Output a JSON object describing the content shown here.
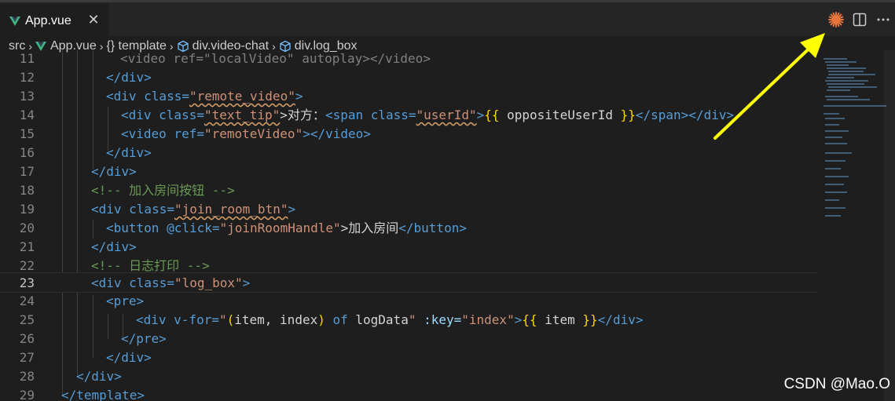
{
  "tab": {
    "title": "App.vue",
    "close": "✕"
  },
  "breadcrumb": [
    {
      "text": "src"
    },
    {
      "text": "App.vue"
    },
    {
      "text": "{} template"
    },
    {
      "text": "div.video-chat"
    },
    {
      "text": "div.log_box"
    }
  ],
  "lines": [
    {
      "n": "11"
    },
    {
      "n": "12"
    },
    {
      "n": "13"
    },
    {
      "n": "14"
    },
    {
      "n": "15"
    },
    {
      "n": "16"
    },
    {
      "n": "17"
    },
    {
      "n": "18"
    },
    {
      "n": "19"
    },
    {
      "n": "20"
    },
    {
      "n": "21"
    },
    {
      "n": "22"
    },
    {
      "n": "23"
    },
    {
      "n": "24"
    },
    {
      "n": "25"
    },
    {
      "n": "26"
    },
    {
      "n": "27"
    },
    {
      "n": "28"
    },
    {
      "n": "29"
    }
  ],
  "code": {
    "l11a": "<video ref=\"localVideo\" autoplay></video>",
    "l12": "</div>",
    "l13a": "<div class=",
    "l13b": "\"remote_video\"",
    "l13c": ">",
    "l14a": "<div class=",
    "l14b": "\"text_tip\"",
    "l14c": ">对方：",
    "l14d": "<span class=",
    "l14e": "\"userId\"",
    "l14f": ">",
    "l14g": "{{",
    "l14h": " oppositeUserId ",
    "l14i": "}}",
    "l14j": "</span></div>",
    "l15a": "<video ref=",
    "l15b": "\"remoteVideo\"",
    "l15c": "></video>",
    "l16": "</div>",
    "l17": "</div>",
    "l18": "<!-- 加入房间按钮 -->",
    "l19a": "<div class=",
    "l19b": "\"join_room_btn\"",
    "l19c": ">",
    "l20a": "<button @click=",
    "l20b": "\"joinRoomHandle\"",
    "l20c": ">加入房间",
    "l20d": "</button>",
    "l21": "</div>",
    "l22": "<!-- 日志打印 -->",
    "l23a": "<div class=",
    "l23b": "\"log_box\"",
    "l23c": ">",
    "l24": "<pre>",
    "l25a": "<div v-for=",
    "l25b": "\"",
    "l25c": "(",
    "l25d": "item, index",
    "l25e": ")",
    "l25f": " of ",
    "l25g": "logData",
    "l25h": "\"",
    "l25i": " :key=",
    "l25j": "\"index\"",
    "l25k": ">",
    "l25l": "{{",
    "l25m": " item ",
    "l25n": "}}",
    "l25o": "</div>",
    "l26": "</pre>",
    "l27": "</div>",
    "l28": "</div>",
    "l29": "</template>"
  },
  "watermark": "CSDN @Mao.O",
  "colors": {
    "vue_green": "#41b883",
    "annotation_arrow": "#ffff00",
    "accent_orange": "#e8743b"
  }
}
